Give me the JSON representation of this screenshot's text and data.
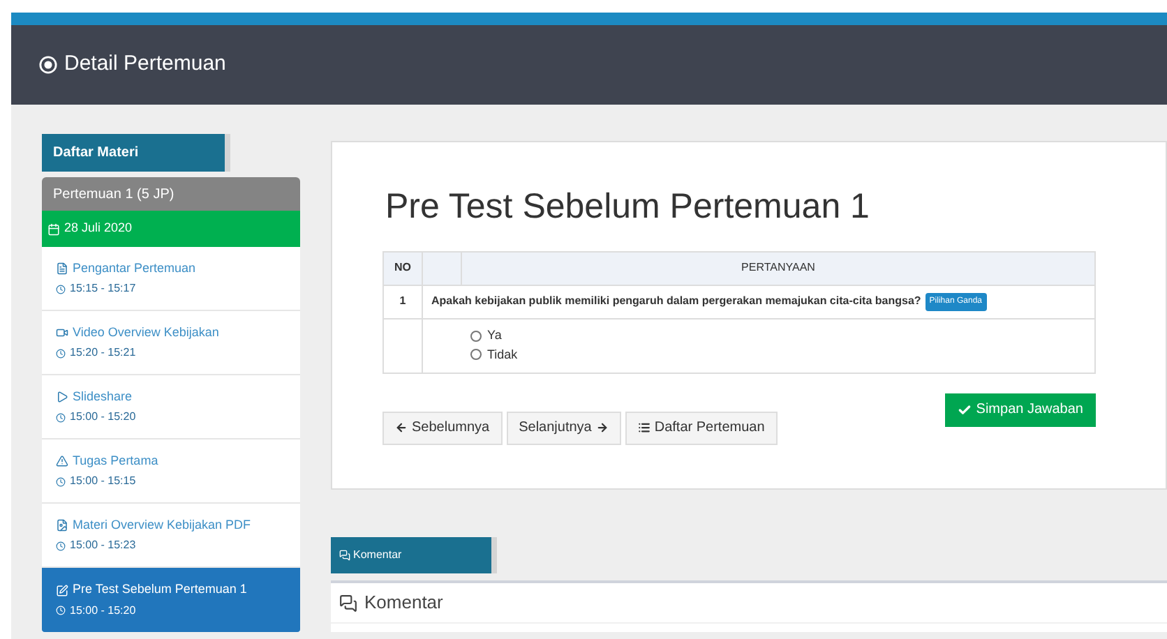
{
  "header": {
    "title": "Detail Pertemuan"
  },
  "sidebar": {
    "tab": "Daftar Materi",
    "section": "Pertemuan 1 (5 JP)",
    "date": "28 Juli 2020",
    "items": [
      {
        "kind": "document",
        "title": "Pengantar Pertemuan",
        "time": "15:15 - 15:17",
        "selected": false
      },
      {
        "kind": "video",
        "title": "Video Overview Kebijakan",
        "time": "15:20 - 15:21",
        "selected": false
      },
      {
        "kind": "play",
        "title": "Slideshare",
        "time": "15:00 - 15:20",
        "selected": false
      },
      {
        "kind": "task",
        "title": "Tugas Pertama",
        "time": "15:00 - 15:15",
        "selected": false
      },
      {
        "kind": "pdf",
        "title": "Materi Overview Kebijakan PDF",
        "time": "15:00 - 15:23",
        "selected": false
      },
      {
        "kind": "quiz",
        "title": "Pre Test Sebelum Pertemuan 1",
        "time": "15:00 - 15:20",
        "selected": true
      }
    ]
  },
  "quiz": {
    "title": "Pre Test Sebelum Pertemuan 1",
    "columns": [
      "NO",
      "PERTANYAAN"
    ],
    "questions": [
      {
        "no": "1",
        "text": "Apakah kebijakan publik memiliki pengaruh dalam pergerakan memajukan cita-cita bangsa?",
        "badge": "Pilihan Ganda",
        "options": [
          {
            "label": "Ya",
            "checked": false
          },
          {
            "label": "Tidak",
            "checked": false
          }
        ]
      }
    ],
    "nav_buttons": [
      {
        "kind": "prev",
        "label": "Sebelumnya"
      },
      {
        "kind": "next",
        "label": "Selanjutnya"
      },
      {
        "kind": "list",
        "label": "Daftar Pertemuan"
      }
    ],
    "save_button": "Simpan Jawaban"
  },
  "comments": {
    "tab": "Komentar",
    "title": "Komentar"
  }
}
